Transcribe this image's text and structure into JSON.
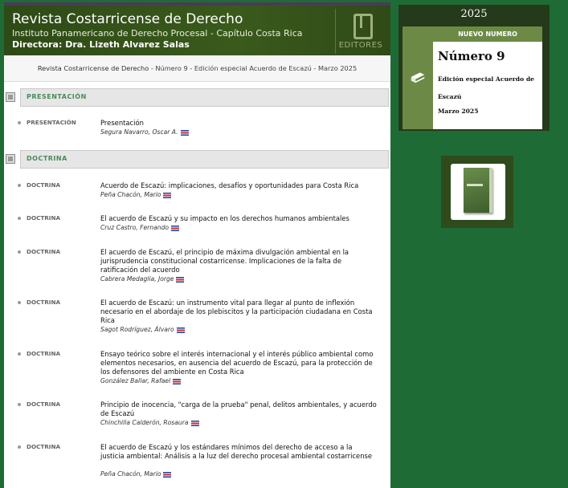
{
  "header": {
    "title": "Revista Costarricense de Derecho",
    "subtitle": "Instituto Panamericano de Derecho Procesal - Capítulo Costa Rica",
    "director": "Directora: Dra. Lizeth Alvarez Salas",
    "logo_text": "EDITORES"
  },
  "breadcrumb": {
    "journal": "Revista Costarricense de Derecho",
    "issue": " - Número 9 - Edición especial Acuerdo de Escazú - Marzo 2025"
  },
  "sections": [
    {
      "label": "PRESENTACIÓN"
    },
    {
      "label": "DOCTRINA"
    }
  ],
  "presentacion": [
    {
      "category": "PRESENTACIÓN",
      "title": "Presentación",
      "author": "Segura Navarro, Oscar A."
    }
  ],
  "doctrina": [
    {
      "category": "DOCTRINA",
      "title": "Acuerdo de Escazú: implicaciones, desafíos y oportunidades para Costa Rica",
      "author": "Peña Chacón, Mario"
    },
    {
      "category": "DOCTRINA",
      "title": "El acuerdo de Escazú y su impacto en los derechos humanos ambientales",
      "author": "Cruz Castro, Fernando"
    },
    {
      "category": "DOCTRINA",
      "title": "El acuerdo de Escazú, el principio de máxima divulgación ambiental en la jurisprudencia constitucional costarricense. Implicaciones de la falta de ratificación del acuerdo",
      "author": "Cabrera Medaglia, Jorge"
    },
    {
      "category": "DOCTRINA",
      "title": "El acuerdo de Escazú: un instrumento vital para llegar al punto de inflexión necesario en el abordaje de los plebiscitos y la participación ciudadana en Costa Rica",
      "author": "Sagot Rodríguez, Álvaro"
    },
    {
      "category": "DOCTRINA",
      "title": "Ensayo teórico sobre el interés internacional y el interés público ambiental como elementos necesarios, en ausencia del acuerdo de Escazú, para la protección de los defensores del ambiente en Costa Rica",
      "author": "González Ballar, Rafael"
    },
    {
      "category": "DOCTRINA",
      "title": "Principio de inocencia, \"carga de la prueba\" penal, delitos ambientales, y acuerdo de Escazú",
      "author": "Chinchilla Calderón, Rosaura"
    },
    {
      "category": "DOCTRINA",
      "title": "El acuerdo de Escazú y los estándares mínimos del derecho de acceso a la justicia ambiental: Análisis a la luz del derecho procesal ambiental costarricense",
      "author": "Peña Chacón, Mario"
    }
  ],
  "sidebar": {
    "year": "2025",
    "new_label": "NUEVO NUMERO",
    "number": "Número 9",
    "edition": "Edición especial Acuerdo de Escazú",
    "date": "Marzo 2025"
  },
  "colors": {
    "background": "#1f6b35",
    "header": "#3a5a1c",
    "accent": "#6c8a45"
  }
}
